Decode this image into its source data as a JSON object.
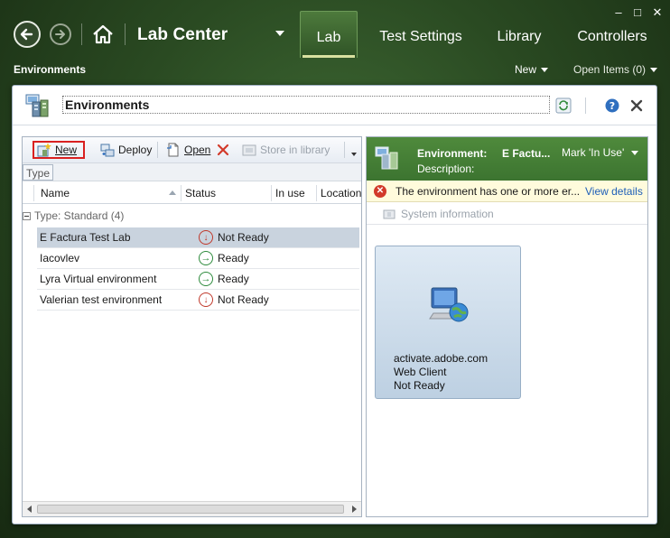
{
  "app": {
    "title": "Lab Center",
    "tabs": [
      "Lab",
      "Test Settings",
      "Library",
      "Controllers"
    ],
    "active_tab": "Lab",
    "window_controls": [
      "–",
      "□",
      "✕"
    ]
  },
  "subbar": {
    "breadcrumb": "Environments",
    "new_label": "New",
    "open_items_label": "Open Items (0)"
  },
  "panel": {
    "title": "Environments",
    "toolbar": {
      "new": "New",
      "deploy": "Deploy",
      "open": "Open",
      "store": "Store in library"
    },
    "group_by_chip": "Type",
    "columns": [
      "Name",
      "Status",
      "In use",
      "Location"
    ],
    "group_header": "Type: Standard (4)",
    "rows": [
      {
        "name": "E Factura Test Lab",
        "status": "Not Ready",
        "state": "red",
        "selected": true
      },
      {
        "name": "Iacovlev",
        "status": "Ready",
        "state": "green",
        "selected": false
      },
      {
        "name": "Lyra Virtual environment",
        "status": "Ready",
        "state": "green",
        "selected": false
      },
      {
        "name": "Valerian test environment",
        "status": "Not Ready",
        "state": "red",
        "selected": false
      }
    ]
  },
  "details": {
    "env_label": "Environment:",
    "env_value": "E Factu...",
    "mark_label": "Mark 'In Use'",
    "desc_label": "Description:",
    "warning": "The environment has one or more er...",
    "view_details": "View details",
    "system_info": "System information",
    "machine": {
      "name": "activate.adobe.com",
      "role": "Web Client",
      "status": "Not Ready"
    }
  }
}
